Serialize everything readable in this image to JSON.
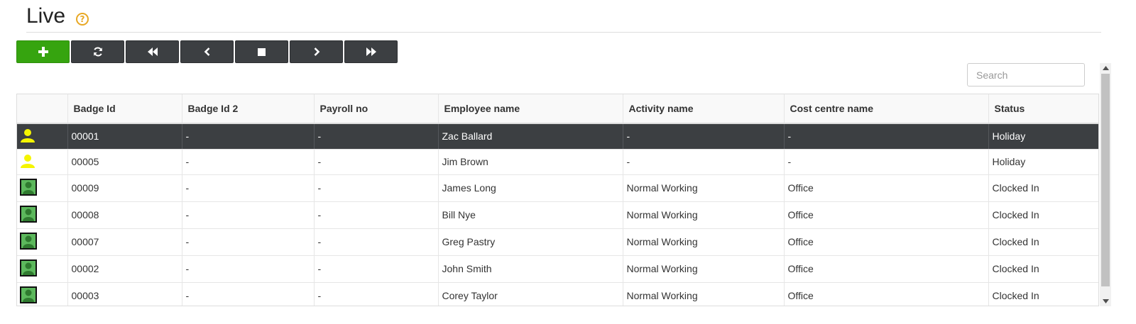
{
  "page": {
    "title": "Live"
  },
  "toolbar": {
    "buttons": [
      {
        "name": "add-button",
        "icon": "plus-icon"
      },
      {
        "name": "refresh-button",
        "icon": "refresh-icon"
      },
      {
        "name": "first-button",
        "icon": "fast-backward-icon"
      },
      {
        "name": "previous-button",
        "icon": "chevron-left-icon"
      },
      {
        "name": "stop-button",
        "icon": "stop-icon"
      },
      {
        "name": "next-button",
        "icon": "chevron-right-icon"
      },
      {
        "name": "last-button",
        "icon": "fast-forward-icon"
      }
    ],
    "accent_color": "#36a40f",
    "dark_color": "#3c3f42"
  },
  "search": {
    "placeholder": "Search",
    "value": ""
  },
  "table": {
    "columns": [
      "",
      "Badge Id",
      "Badge Id 2",
      "Payroll no",
      "Employee name",
      "Activity name",
      "Cost centre name",
      "Status"
    ],
    "rows": [
      {
        "icon": "holiday-person-icon",
        "badge_id": "00001",
        "badge_id_2": "-",
        "payroll_no": "-",
        "employee_name": "Zac Ballard",
        "activity_name": "-",
        "cost_centre_name": "-",
        "status": "Holiday"
      },
      {
        "icon": "holiday-person-icon",
        "badge_id": "00005",
        "badge_id_2": "-",
        "payroll_no": "-",
        "employee_name": "Jim Brown",
        "activity_name": "-",
        "cost_centre_name": "-",
        "status": "Holiday"
      },
      {
        "icon": "clocked-in-person-icon",
        "badge_id": "00009",
        "badge_id_2": "-",
        "payroll_no": "-",
        "employee_name": "James Long",
        "activity_name": "Normal Working",
        "cost_centre_name": "Office",
        "status": "Clocked In"
      },
      {
        "icon": "clocked-in-person-icon",
        "badge_id": "00008",
        "badge_id_2": "-",
        "payroll_no": "-",
        "employee_name": "Bill Nye",
        "activity_name": "Normal Working",
        "cost_centre_name": "Office",
        "status": "Clocked In"
      },
      {
        "icon": "clocked-in-person-icon",
        "badge_id": "00007",
        "badge_id_2": "-",
        "payroll_no": "-",
        "employee_name": "Greg Pastry",
        "activity_name": "Normal Working",
        "cost_centre_name": "Office",
        "status": "Clocked In"
      },
      {
        "icon": "clocked-in-person-icon",
        "badge_id": "00002",
        "badge_id_2": "-",
        "payroll_no": "-",
        "employee_name": "John Smith",
        "activity_name": "Normal Working",
        "cost_centre_name": "Office",
        "status": "Clocked In"
      },
      {
        "icon": "clocked-in-person-icon",
        "badge_id": "00003",
        "badge_id_2": "-",
        "payroll_no": "-",
        "employee_name": "Corey Taylor",
        "activity_name": "Normal Working",
        "cost_centre_name": "Office",
        "status": "Clocked In"
      }
    ],
    "selected_row_index": 0,
    "status_colors": {
      "holiday": "#f5f500",
      "clocked_in": "#5cb85c"
    }
  }
}
